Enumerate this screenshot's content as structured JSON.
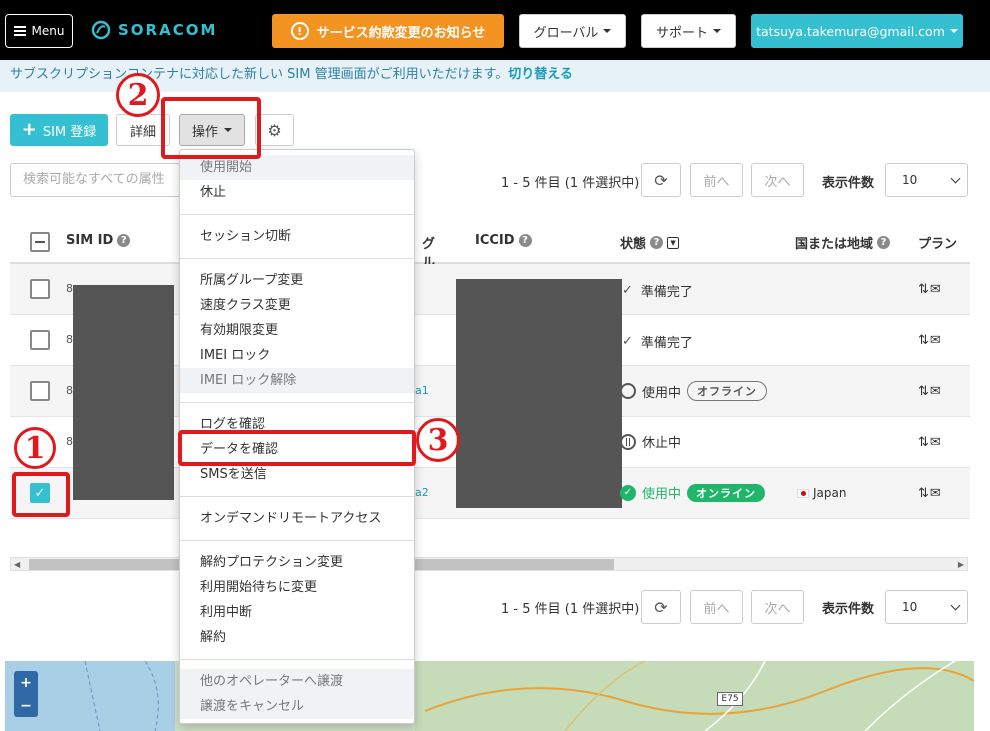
{
  "topbar": {
    "menu_label": "Menu",
    "logo_text": "SORACOM",
    "notice_button": "サービス約款変更のお知らせ",
    "global_dropdown": "グローバル",
    "support_dropdown": "サポート",
    "user_email": "tatsuya.takemura@gmail.com"
  },
  "banner": {
    "text": "サブスクリプションコンテナに対応した新しい SIM 管理画面がご利用いただけます。",
    "link": "切り替える"
  },
  "toolbar": {
    "sim_register": "SIM 登録",
    "detail": "詳細",
    "operations": "操作",
    "search_placeholder": "検索可能なすべての属性"
  },
  "pager": {
    "summary": "1 - 5 件目 (1 件選択中)",
    "prev": "前へ",
    "next": "次へ",
    "per_page_label": "表示件数",
    "per_page_value": "10"
  },
  "table": {
    "columns": {
      "sim_id": "SIM ID",
      "group": "グループ",
      "iccid": "ICCID",
      "status": "状態",
      "country": "国または地域",
      "plan": "プラン"
    },
    "rows": [
      {
        "status": "準備完了",
        "session": "",
        "country": "",
        "group": ""
      },
      {
        "status": "準備完了",
        "session": "",
        "country": "",
        "group": ""
      },
      {
        "status": "使用中",
        "session": "オフライン",
        "country": "",
        "group": "a1"
      },
      {
        "status": "休止中",
        "session": "",
        "country": "",
        "group": ""
      },
      {
        "status": "使用中",
        "session": "オンライン",
        "country": "Japan",
        "group": "a2"
      }
    ],
    "row_actions": "⇅✉"
  },
  "dropdown": {
    "items": [
      "使用開始",
      "休止",
      "セッション切断",
      "所属グループ変更",
      "速度クラス変更",
      "有効期限変更",
      "IMEI ロック",
      "IMEI ロック解除",
      "ログを確認",
      "データを確認",
      "SMSを送信",
      "オンデマンドリモートアクセス",
      "解約プロテクション変更",
      "利用開始待ちに変更",
      "利用中断",
      "解約",
      "他のオペレーターへ譲渡",
      "譲渡をキャンセル"
    ]
  },
  "map": {
    "zoom_in": "+",
    "zoom_out": "−",
    "road_label": "E75"
  },
  "annotations": {
    "step1": "1",
    "step2": "2",
    "step3": "3"
  },
  "colors": {
    "accent": "#35c0d2",
    "notice": "#f39322",
    "annotation_red": "#e0191c",
    "online_green": "#20b66a"
  }
}
